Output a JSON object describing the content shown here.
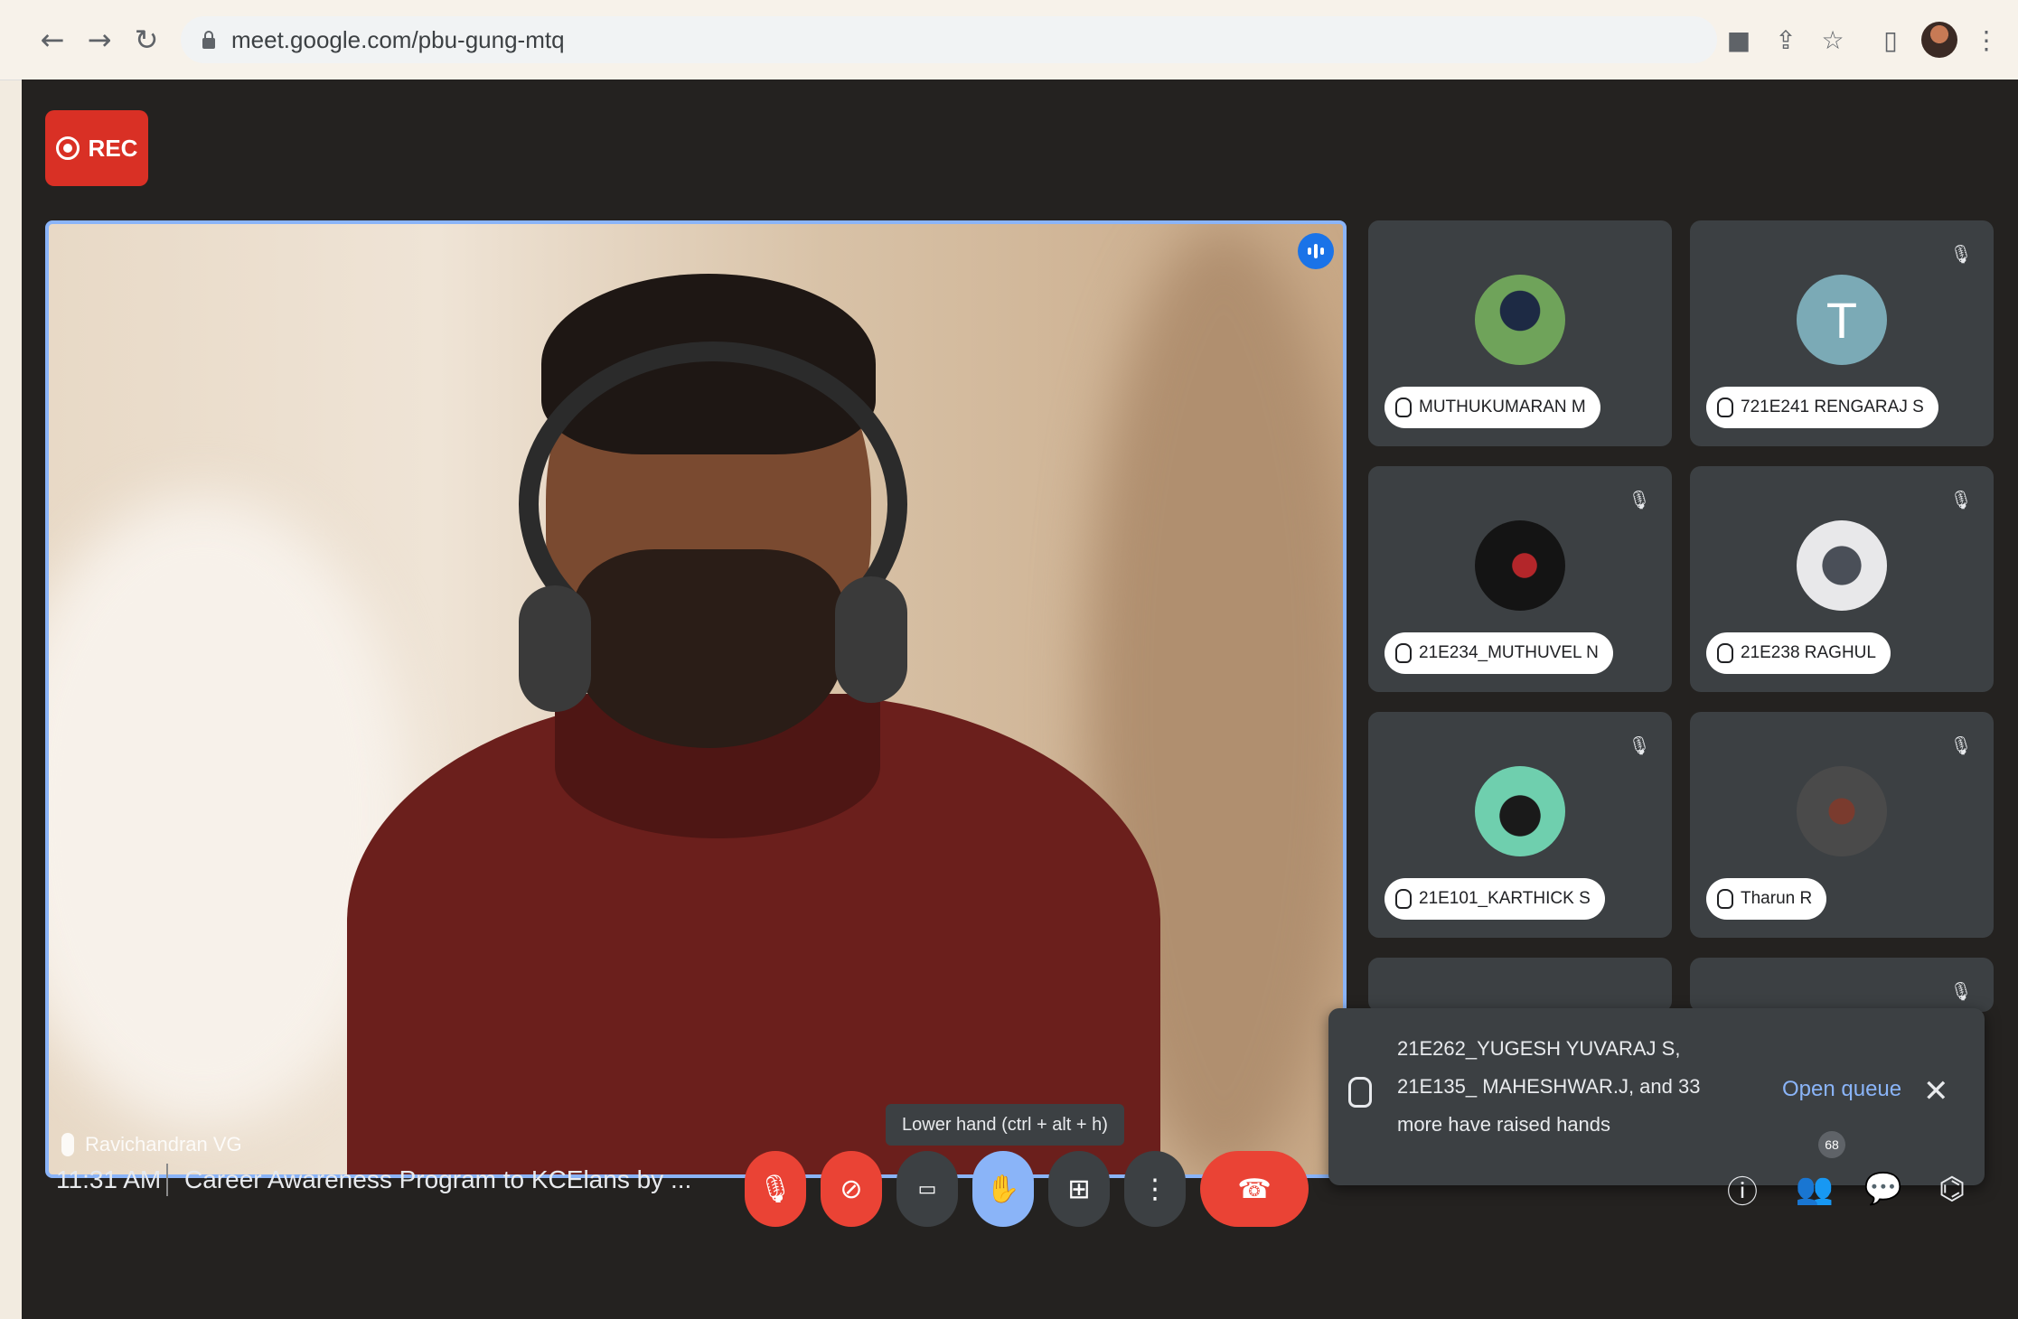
{
  "browser": {
    "url": "meet.google.com/pbu-gung-mtq",
    "back_icon": "arrow-left-icon",
    "forward_icon": "arrow-right-icon",
    "reload_icon": "reload-icon"
  },
  "meeting": {
    "rec_label": "REC",
    "main_speaker_name": "Ravichandran VG",
    "time": "11:31 AM",
    "title": "Career Awareness Program to KCElans by ..."
  },
  "tiles": [
    {
      "name": "MUTHUKUMARAN M",
      "avatar": "photo",
      "muted": false
    },
    {
      "name": "721E241 RENGARAJ S",
      "avatar": "letter",
      "letter": "T",
      "muted": true
    },
    {
      "name": "21E234_MUTHUVEL N",
      "avatar": "photo",
      "muted": true
    },
    {
      "name": "21E238 RAGHUL",
      "avatar": "photo",
      "muted": true
    },
    {
      "name": "21E101_KARTHICK S",
      "avatar": "photo",
      "muted": true
    },
    {
      "name": "Tharun R",
      "avatar": "photo",
      "muted": true
    }
  ],
  "raised_hands": {
    "text": "21E262_YUGESH YUVARAJ S, 21E135_ MAHESHWAR.J, and 33 more have raised hands",
    "open_queue": "Open queue"
  },
  "tooltip": "Lower hand (ctrl + alt + h)",
  "controls": [
    "mic-off-icon",
    "camera-off-icon",
    "captions-icon",
    "hand-raised-icon",
    "present-icon",
    "more-options-icon",
    "end-call-icon"
  ],
  "people_count": "68",
  "colors": {
    "accent_blue": "#8ab4f8",
    "red": "#ea4335",
    "tile_bg": "#3c4043",
    "meet_bg": "#242220"
  }
}
